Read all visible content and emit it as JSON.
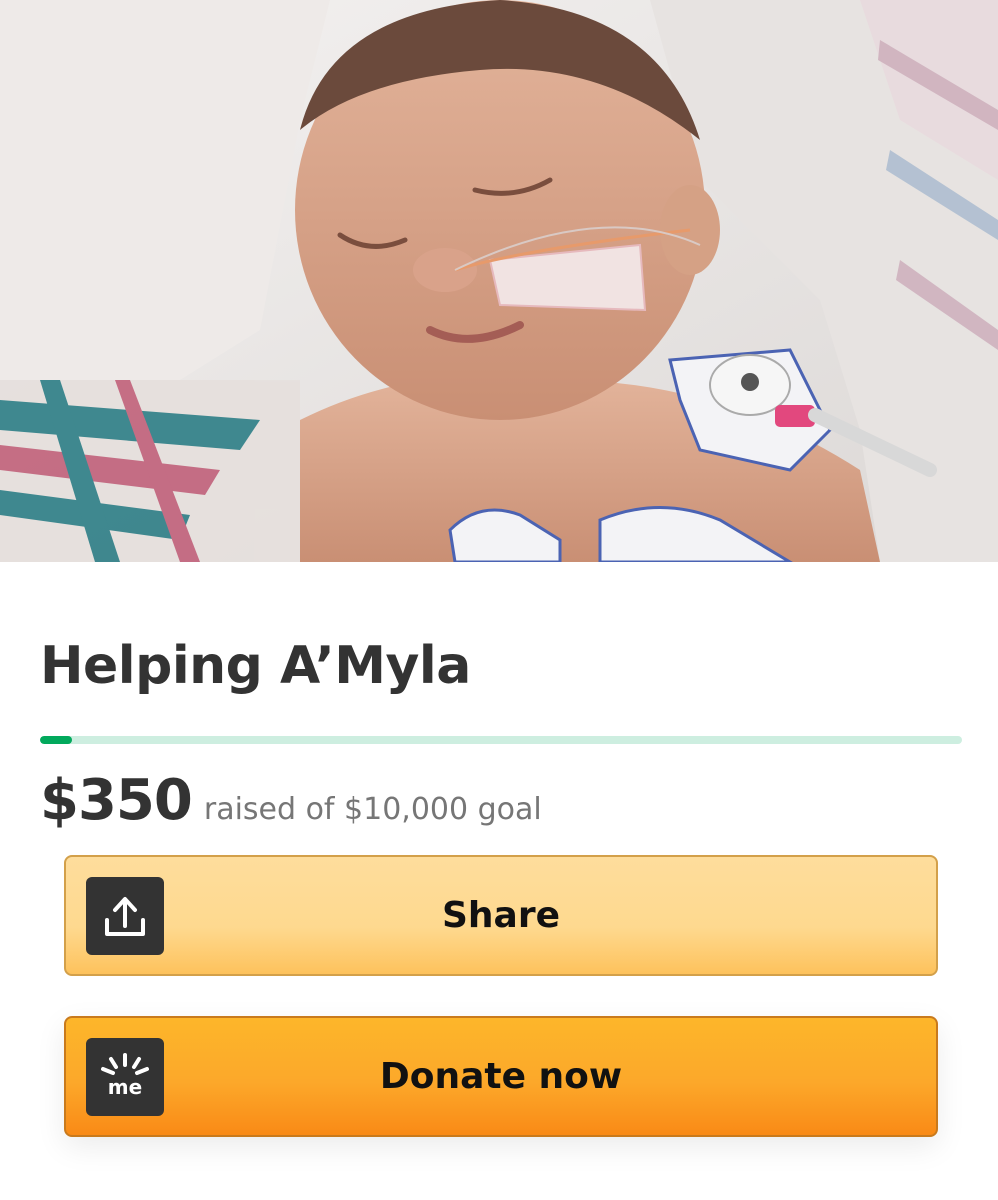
{
  "campaign": {
    "title": "Helping A’Myla",
    "raised_amount": "$350",
    "raised_text": "raised of $10,000 goal",
    "progress_fraction": 0.035
  },
  "actions": {
    "share_label": "Share",
    "donate_label": "Donate now",
    "share_icon": "share-upload-icon",
    "donate_icon": "gofundme-me-logo-icon"
  },
  "colors": {
    "progress_fill": "#02a95c",
    "progress_track": "#cdeee0",
    "share_button": "#fed98f",
    "donate_button": "#fca82a",
    "icon_tile": "#333333"
  },
  "hero_image": {
    "icon": "photo-sleeping-newborn"
  }
}
